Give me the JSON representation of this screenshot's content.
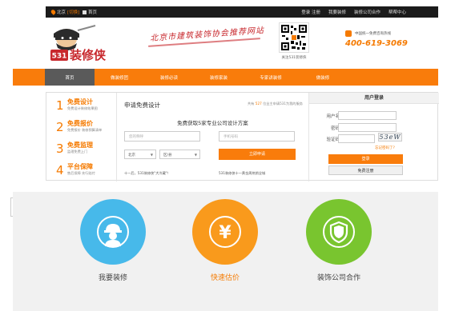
{
  "topbar": {
    "city": "北京",
    "switch_label": "[切换]",
    "home_label": "首页",
    "links": [
      "登录 注册",
      "我要装修",
      "装修公司合作",
      "帮帮中心"
    ]
  },
  "header": {
    "logo_text": "531装修侠",
    "slogan": "北京市建筑装饰协会推荐网站",
    "qr_caption": "关注531装修侠",
    "hotline_label": "中国统一免费咨询热线",
    "hotline_number": "400-619-3069"
  },
  "nav": {
    "items": [
      "首页",
      "做装修团",
      "装修必读",
      "装修家装",
      "专家讲装修",
      "做装修"
    ]
  },
  "steps": [
    {
      "num": "1",
      "title": "免费设计",
      "desc": "免费设计装修效果图"
    },
    {
      "num": "2",
      "title": "免费报价",
      "desc": "免费报价 装修预算清单"
    },
    {
      "num": "3",
      "title": "免费监理",
      "desc": "监理免费上门"
    },
    {
      "num": "4",
      "title": "平台保障",
      "desc": "售后保障 先行赔付"
    }
  ],
  "apply": {
    "title": "申请免费设计",
    "count_prefix": "共有",
    "count_value": "527",
    "count_suffix": "位业主申请531为我的服务",
    "subtitle": "免费获取5家专业公司设计方案",
    "name_placeholder": "您的称呼",
    "phone_placeholder": "手机号码",
    "city_value": "北京",
    "district_value": "区/县",
    "submit_label": "立即申请",
    "note_left": "十一后，531装修侠\"大冷藏\"！",
    "note_right": "531装修侠十一黄金周热销全城"
  },
  "login": {
    "title": "用户登录",
    "username_label": "用户名",
    "password_label": "密码",
    "captcha_label": "验证码",
    "captcha_text": "53eW",
    "forgot_label": "忘记密码了?",
    "login_button": "登录",
    "register_button": "免费注册"
  },
  "services": [
    {
      "label": "我要装修",
      "color": "#47b9ea",
      "icon": "worker-icon"
    },
    {
      "label": "快速估价",
      "color": "#f99a1c",
      "icon": "yen-icon"
    },
    {
      "label": "装饰公司合作",
      "color": "#79c52f",
      "icon": "shield-icon"
    }
  ],
  "colors": {
    "accent": "#f97c0b",
    "dark": "#1b1b1b",
    "red": "#c8282d"
  }
}
